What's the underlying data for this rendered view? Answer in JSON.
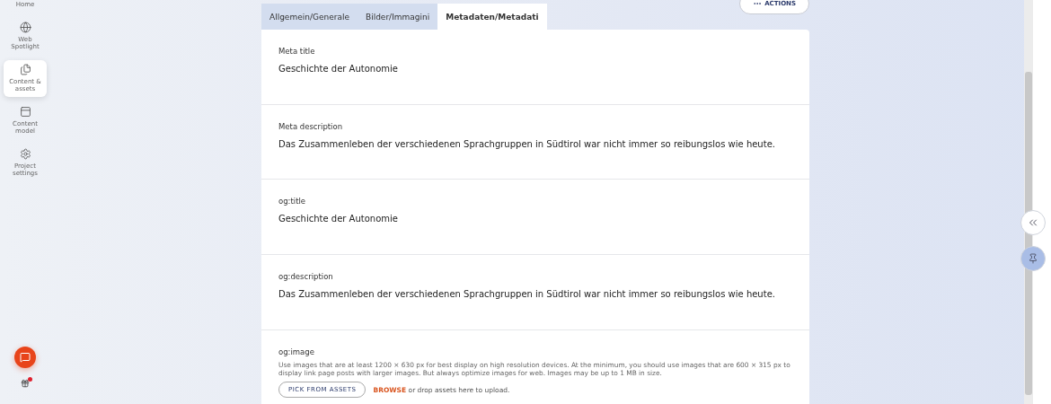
{
  "sidebar": {
    "items": [
      {
        "label": "Home",
        "selected": false
      },
      {
        "label": "Web Spotlight",
        "selected": false
      },
      {
        "label": "Content & assets",
        "selected": true
      },
      {
        "label": "Content model",
        "selected": false
      },
      {
        "label": "Project settings",
        "selected": false
      }
    ],
    "notification": true
  },
  "actions_button": {
    "label": "ACTIONS"
  },
  "tabs": [
    {
      "label": "Allgemein/Generale",
      "selected": false
    },
    {
      "label": "Bilder/Immagini",
      "selected": false
    },
    {
      "label": "Metadaten/Metadati",
      "selected": true
    }
  ],
  "fields": [
    {
      "kind": "text",
      "label": "Meta title",
      "value": "Geschichte der Autonomie"
    },
    {
      "kind": "text",
      "label": "Meta description",
      "value": "Das Zusammenleben der verschiedenen Sprachgruppen in Südtirol war nicht immer so reibungslos wie heute."
    },
    {
      "kind": "text",
      "label": "og:title",
      "value": "Geschichte der Autonomie"
    },
    {
      "kind": "text",
      "label": "og:description",
      "value": "Das Zusammenleben der verschiedenen Sprachgruppen in Südtirol war nicht immer so reibungslos wie heute."
    },
    {
      "kind": "asset",
      "label": "og:image",
      "hint": "Use images that are at least 1200 × 630 px for best display on high resolution devices. At the minimum, you should use images that are 600 × 315 px to display link page posts with larger images. But always optimize images for web. Images may be up to 1 MB in size.",
      "pick_button": "PICK FROM ASSETS",
      "browse_link": "BROWSE",
      "drop_text": "or drop assets here to upload."
    }
  ]
}
